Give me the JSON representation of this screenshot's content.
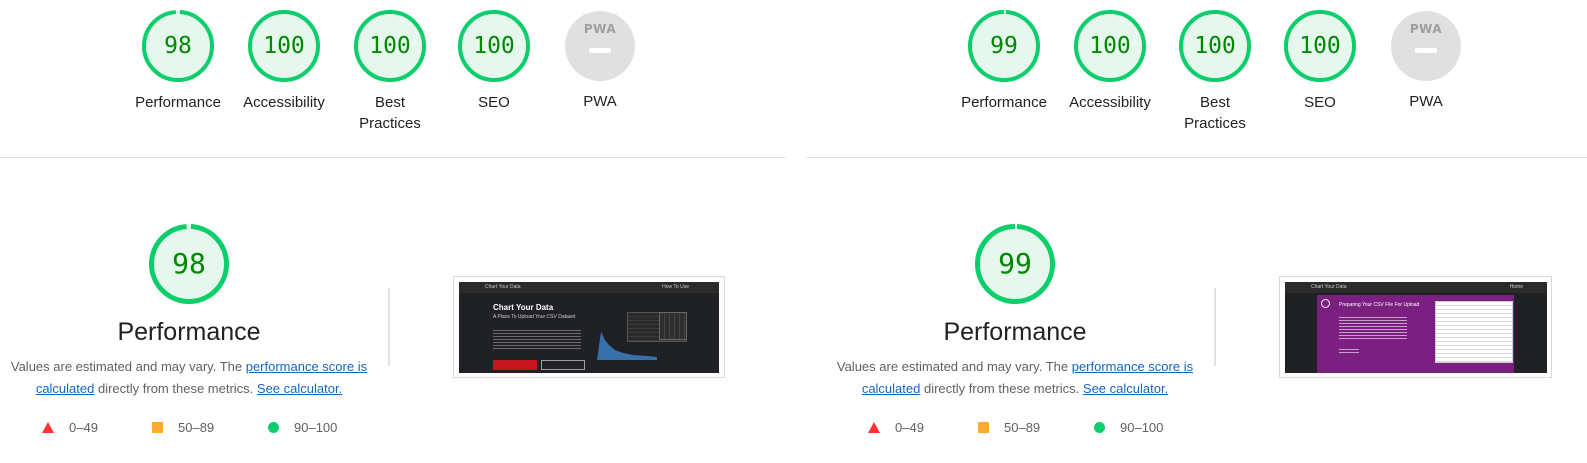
{
  "colors": {
    "pass": "#0cce6b",
    "pass_text": "#008800",
    "pass_fill": "#e6f8ee",
    "average": "#ffaa33",
    "fail": "#ff3333",
    "link": "#1565c0",
    "na": "#e0e0e0"
  },
  "reports": [
    {
      "gauges": [
        {
          "score": "98",
          "label": "Performance",
          "fraction": 0.98
        },
        {
          "score": "100",
          "label": "Accessibility",
          "fraction": 1.0
        },
        {
          "score": "100",
          "label": "Best Practices",
          "fraction": 1.0
        },
        {
          "score": "100",
          "label": "SEO",
          "fraction": 1.0
        }
      ],
      "pwa": {
        "badge_text": "PWA",
        "label": "PWA"
      },
      "performance": {
        "score": "98",
        "fraction": 0.98,
        "title": "Performance",
        "desc_prefix": "Values are estimated and may vary. The ",
        "desc_link": "performance score is calculated",
        "desc_middle": " directly from these metrics. ",
        "calc_link": "See calculator."
      },
      "legend": {
        "fail": "0–49",
        "average": "50–89",
        "pass": "90–100"
      },
      "screenshot": {
        "brand": "Chart Your Data",
        "nav": "How To Use",
        "headline": "Chart Your Data",
        "subheadline": "A Place To Upload Your CSV Dataset",
        "theme": "dark"
      }
    },
    {
      "gauges": [
        {
          "score": "99",
          "label": "Performance",
          "fraction": 0.99
        },
        {
          "score": "100",
          "label": "Accessibility",
          "fraction": 1.0
        },
        {
          "score": "100",
          "label": "Best Practices",
          "fraction": 1.0
        },
        {
          "score": "100",
          "label": "SEO",
          "fraction": 1.0
        }
      ],
      "pwa": {
        "badge_text": "PWA",
        "label": "PWA"
      },
      "performance": {
        "score": "99",
        "fraction": 0.99,
        "title": "Performance",
        "desc_prefix": "Values are estimated and may vary. The ",
        "desc_link": "performance score is calculated",
        "desc_middle": " directly from these metrics. ",
        "calc_link": "See calculator."
      },
      "legend": {
        "fail": "0–49",
        "average": "50–89",
        "pass": "90–100"
      },
      "screenshot": {
        "brand": "Chart Your Data",
        "nav": "Home",
        "headline": "Preparing Your CSV File For Upload",
        "theme": "purple"
      }
    }
  ]
}
